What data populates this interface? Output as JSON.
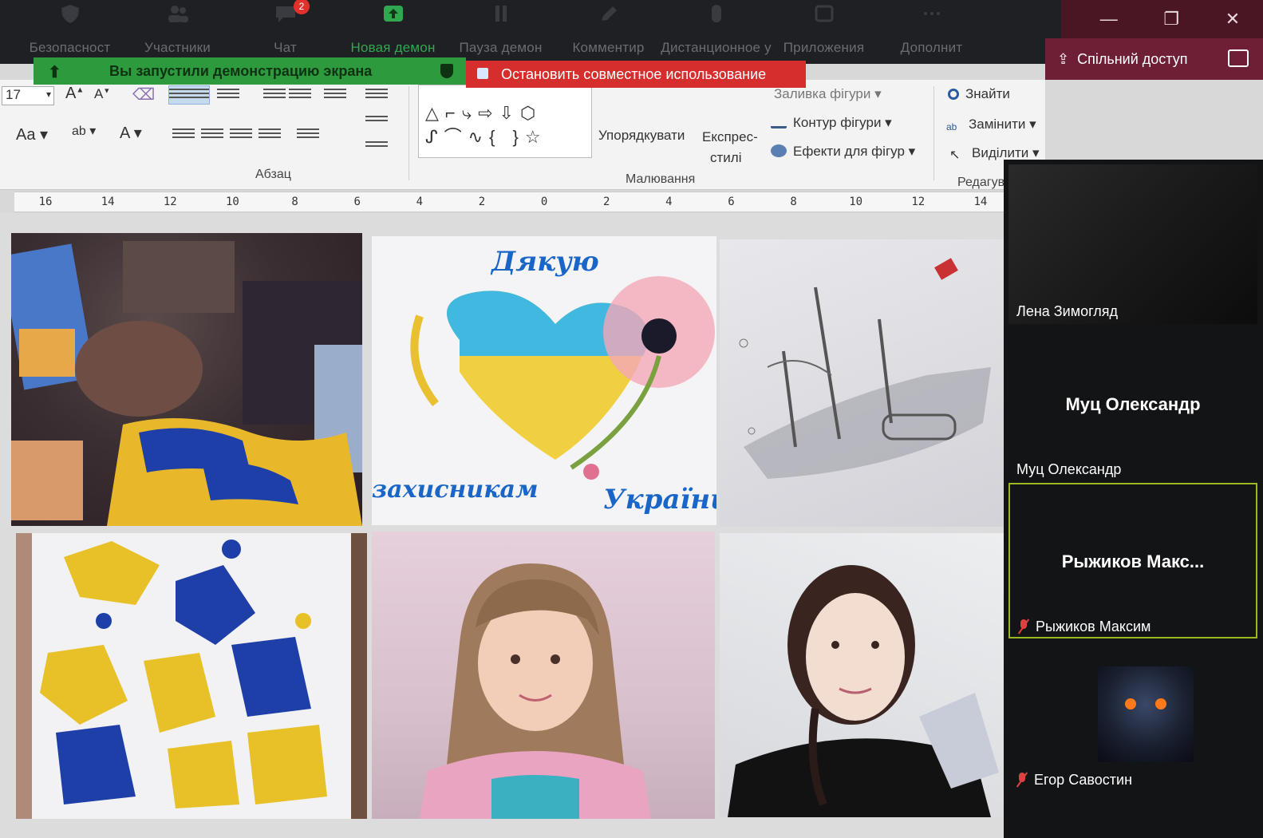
{
  "toolbar": {
    "items": [
      {
        "label": "Безопасност",
        "icon": "shield-icon"
      },
      {
        "label": "Участники",
        "icon": "participants-icon"
      },
      {
        "label": "Чат",
        "icon": "chat-icon",
        "badge": "2"
      },
      {
        "label": "Новая демон",
        "icon": "share-screen-icon",
        "active": true
      },
      {
        "label": "Пауза демон",
        "icon": "pause-icon"
      },
      {
        "label": "Комментир",
        "icon": "annotate-icon"
      },
      {
        "label": "Дистанционное у",
        "icon": "remote-control-icon"
      },
      {
        "label": "Приложения",
        "icon": "apps-icon"
      },
      {
        "label": "Дополнит",
        "icon": "more-icon"
      }
    ]
  },
  "window": {
    "minimize": "—",
    "restore": "❐",
    "close": "✕",
    "share_label": "Спільний доступ"
  },
  "banners": {
    "sharing": "Вы запустили демонстрацию экрана",
    "stop": "Остановить совместное использование"
  },
  "ribbon": {
    "font_size": "17",
    "groups": {
      "paragraph": "Абзац",
      "drawing": "Малювання",
      "editing": "Редагува"
    },
    "arrange": "Упорядкувати",
    "quick_styles_line1": "Експрес-",
    "quick_styles_line2": "стилі",
    "shape_fill": "Заливка фігури",
    "shape_outline": "Контур фігури",
    "shape_effects": "Ефекти для фігур",
    "find": "Знайти",
    "replace": "Замінити",
    "select": "Виділити"
  },
  "ruler": [
    "16",
    "14",
    "12",
    "10",
    "8",
    "6",
    "4",
    "2",
    "0",
    "2",
    "4",
    "6",
    "8",
    "10",
    "12",
    "14"
  ],
  "slide": {
    "drawing_title": "Дякую",
    "drawing_caption1": "захисникам",
    "drawing_caption2": "України"
  },
  "participants": [
    {
      "name": "Лена Зимогляд"
    },
    {
      "display": "Муц Олександр",
      "name": "Муц Олександр"
    },
    {
      "display": "Рыжиков  Макс...",
      "name": "Рыжиков Максим",
      "muted": true
    },
    {
      "name": "Егор Савостин",
      "muted": true
    }
  ],
  "colors": {
    "sharing_green": "#2e9a3e",
    "stop_red": "#d62d2d",
    "toolbar_bg": "#1f2023",
    "active_green": "#2fa84f"
  }
}
